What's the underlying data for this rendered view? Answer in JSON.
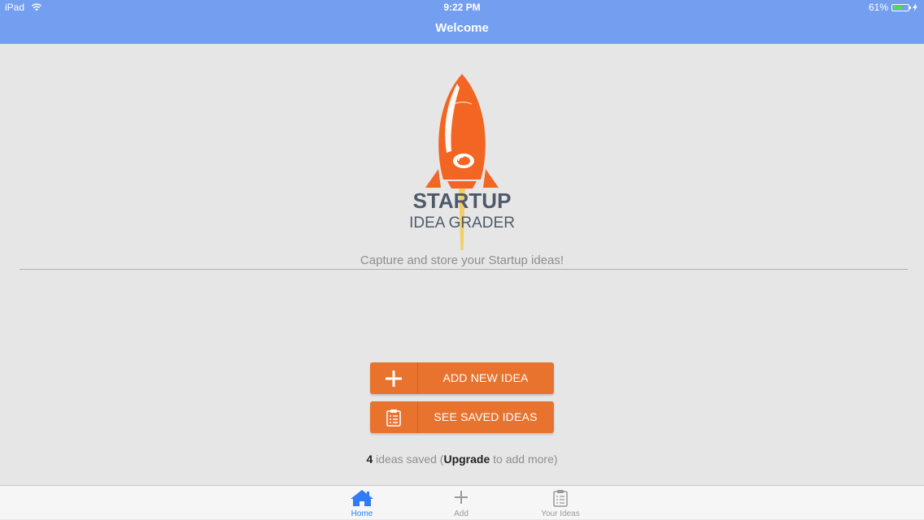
{
  "status_bar": {
    "device": "iPad",
    "time": "9:22 PM",
    "battery_percent": "61%",
    "battery_level": 0.61
  },
  "nav": {
    "title": "Welcome"
  },
  "brand": {
    "line1": "STARTUP",
    "line2": "IDEA GRADER",
    "tagline": "Capture and store your Startup ideas!"
  },
  "buttons": {
    "add_new_idea": "ADD NEW IDEA",
    "see_saved_ideas": "SEE SAVED IDEAS"
  },
  "ideas_status": {
    "count": "4",
    "text_before": " ideas saved (",
    "upgrade": "Upgrade",
    "text_after": " to add more)"
  },
  "tabs": [
    {
      "label": "Home",
      "icon": "home-icon",
      "active": true
    },
    {
      "label": "Add",
      "icon": "plus-icon",
      "active": false
    },
    {
      "label": "Your Ideas",
      "icon": "clipboard-icon",
      "active": false
    }
  ],
  "colors": {
    "header": "#749ef0",
    "accent_orange": "#e8732f",
    "rocket_orange": "#f26522",
    "tab_active": "#2f7cf6"
  }
}
